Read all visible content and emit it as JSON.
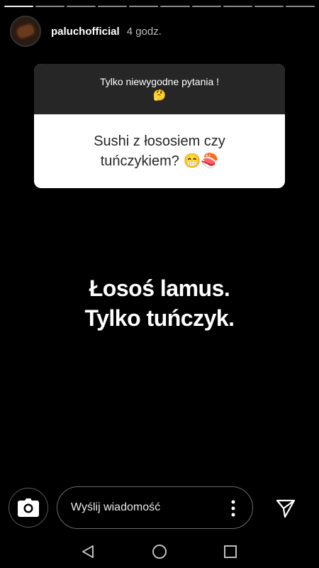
{
  "story": {
    "segments": 10,
    "username": "paluchofficial",
    "time": "4 godz."
  },
  "question": {
    "prompt": "Tylko niewygodne pytania !",
    "prompt_emoji": "🤔",
    "answer": "Sushi z łososiem czy tuńczykiem? 😁🍣"
  },
  "text": {
    "line1": "Łosoś lamus.",
    "line2": "Tylko tuńczyk."
  },
  "reply": {
    "placeholder": "Wyślij wiadomość"
  },
  "colors": {
    "background": "#000000",
    "question_header": "#262626",
    "question_body": "#ffffff"
  }
}
